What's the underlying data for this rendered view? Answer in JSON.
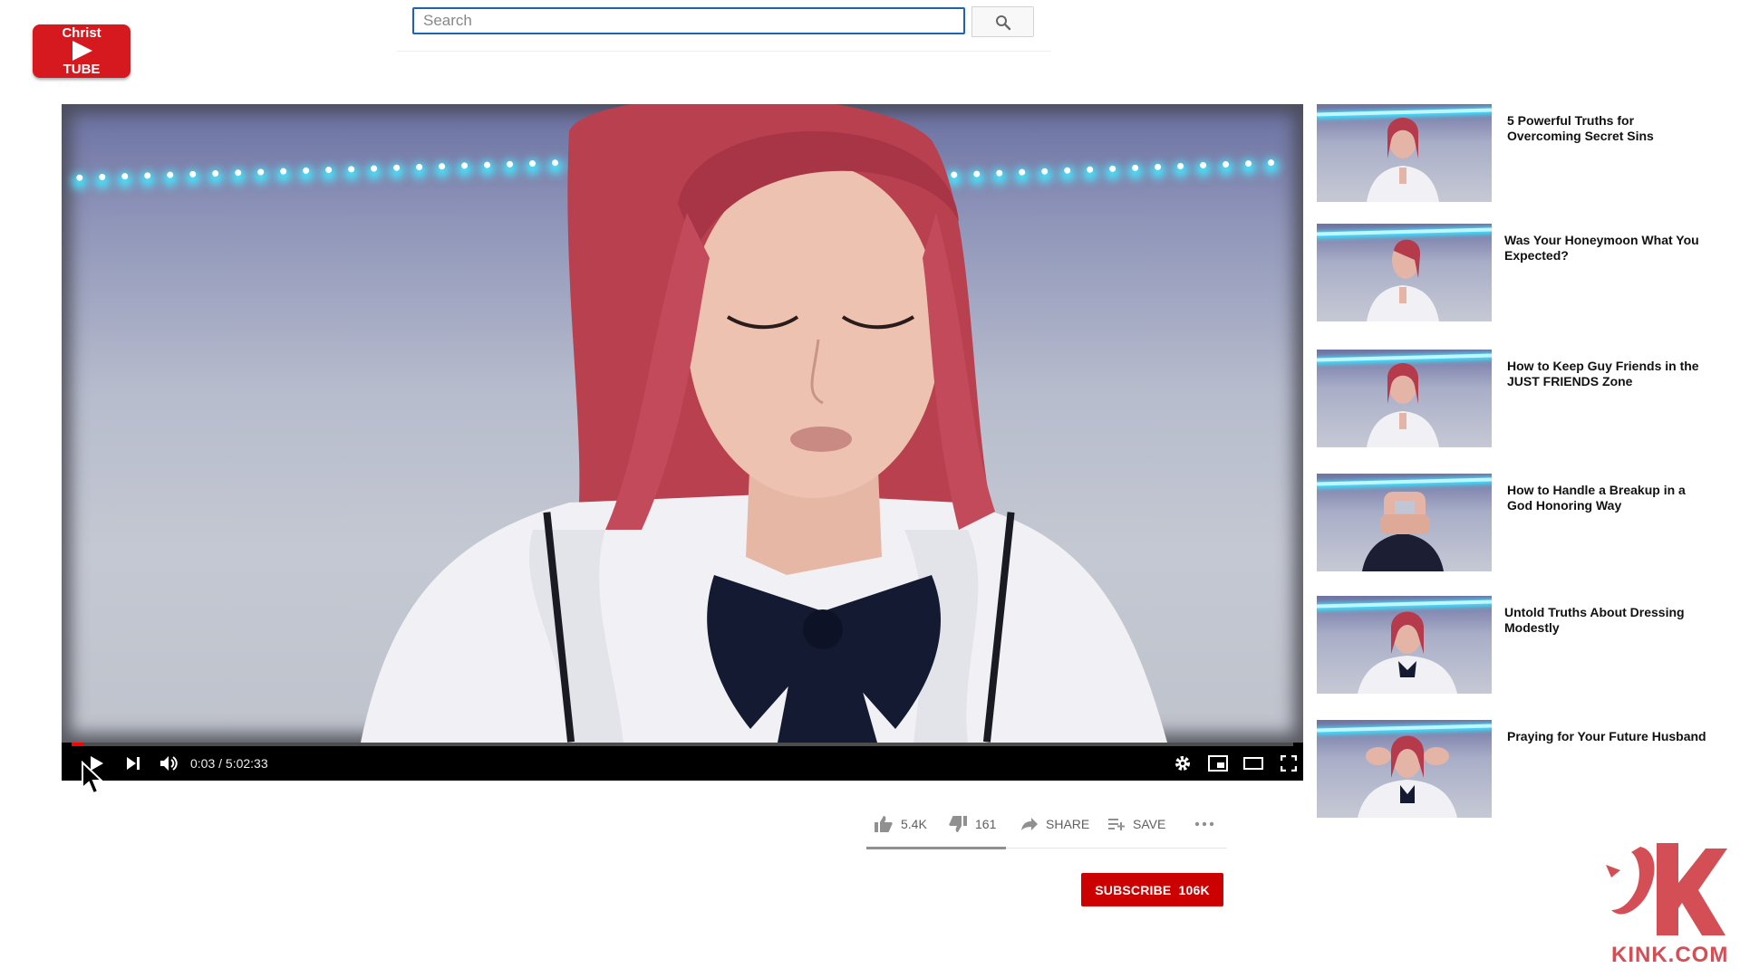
{
  "logo": {
    "line1": "Christ",
    "line2": "TUBE"
  },
  "search": {
    "placeholder": "Search",
    "value": ""
  },
  "player": {
    "time_current": "0:03",
    "time_separator": "/",
    "time_total": "5:02:33",
    "progress_fraction": 0.01
  },
  "actions": {
    "likes": "5.4K",
    "dislikes": "161",
    "share": "SHARE",
    "save": "SAVE"
  },
  "subscribe": {
    "label": "SUBSCRIBE",
    "count": "106K"
  },
  "recommendations": [
    {
      "title": "5 Powerful Truths for Overcoming Secret Sins"
    },
    {
      "title": "Was Your Honeymoon What You Expected?"
    },
    {
      "title": "How to Keep Guy Friends in the JUST FRIENDS Zone"
    },
    {
      "title": "How to Handle a Breakup in a God Honoring Way"
    },
    {
      "title": "Untold Truths About Dressing Modestly"
    },
    {
      "title": "Praying for Your Future Husband"
    }
  ],
  "watermark": {
    "text": "KINK.COM"
  },
  "colors": {
    "brand_red": "#d6191e",
    "subscribe_red": "#cc0000",
    "search_border": "#1c62b9",
    "led_cyan": "#46e8ff"
  }
}
